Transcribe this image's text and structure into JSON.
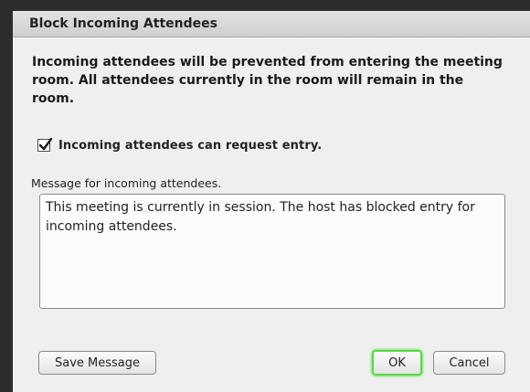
{
  "dialog": {
    "title": "Block Incoming Attendees",
    "intro": "Incoming attendees will be prevented from entering the meeting room. All attendees currently in the room will remain in the room.",
    "request_entry": {
      "label": "Incoming attendees can request entry.",
      "checked": true
    },
    "message": {
      "label": "Message for incoming attendees.",
      "value": "This meeting is currently in session. The host has blocked entry for incoming attendees."
    },
    "buttons": {
      "save_label": "Save Message",
      "ok_label": "OK",
      "cancel_label": "Cancel"
    }
  },
  "colors": {
    "dialog_bg": "#efefef",
    "frame": "#2d2d2d",
    "ok_focus": "#5bd64a"
  },
  "icons": {
    "checkbox": "checkmark-icon"
  }
}
